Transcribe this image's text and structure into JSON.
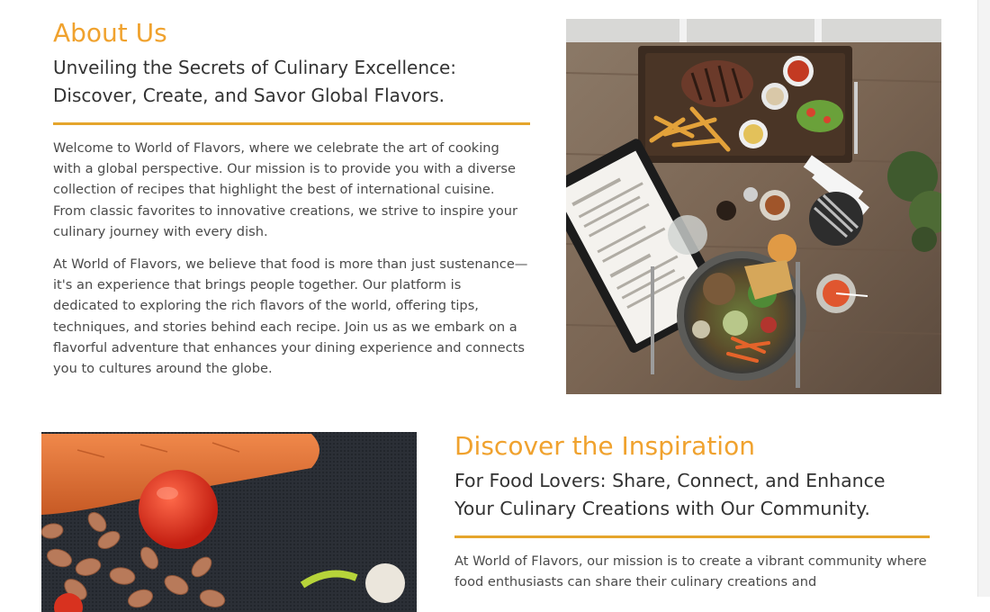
{
  "about": {
    "heading": "About Us",
    "subheading_line1": "Unveiling the Secrets of Culinary Excellence:",
    "subheading_line2": "Discover, Create, and Savor Global Flavors.",
    "paragraph1": "Welcome to World of Flavors, where we celebrate the art of cooking with a global perspective. Our mission is to provide you with a diverse collection of recipes that highlight the best of international cuisine. From classic favorites to innovative creations, we strive to inspire your culinary journey with every dish.",
    "paragraph2": "At World of Flavors, we believe that food is more than just sustenance—it's an experience that brings people together. Our platform is dedicated to exploring the rich flavors of the world, offering tips, techniques, and stories behind each recipe. Join us as we embark on a flavorful adventure that enhances your dining experience and connects you to cultures around the globe."
  },
  "inspiration": {
    "heading": "Discover the Inspiration",
    "subheading_line1": "For Food Lovers: Share, Connect, and Enhance",
    "subheading_line2": "Your Culinary Creations with Our Community.",
    "paragraph1": "At World of Flavors, our mission is to create a vibrant community where food enthusiasts can share their culinary creations and"
  },
  "colors": {
    "accent": "#f0a22e",
    "divider": "#e5a52c",
    "heading_text": "#333333",
    "body_text": "#4a4a4a"
  }
}
